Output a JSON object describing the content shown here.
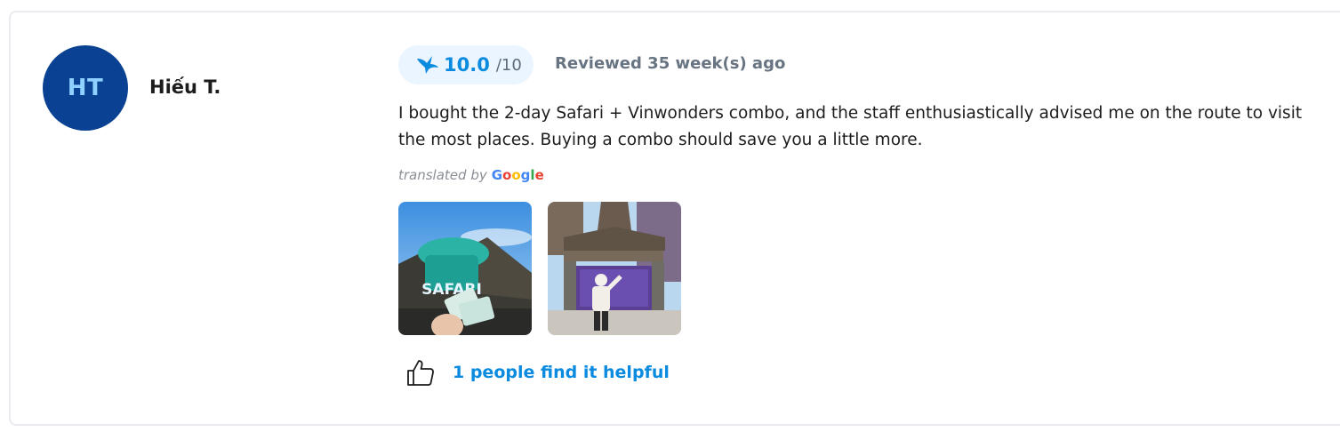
{
  "reviewer": {
    "initials": "HT",
    "name": "Hiếu T."
  },
  "rating": {
    "score": "10.0",
    "scale": "/10"
  },
  "review": {
    "date": "Reviewed 35 week(s) ago",
    "text": "I bought the 2-day Safari + Vinwonders combo, and the staff enthusiastically advised me on the route to visit the most places. Buying a combo should save you a little more.",
    "translated_by": "translated by",
    "translator": "Google"
  },
  "photos": [
    {
      "sign_text": "SAFARI"
    },
    {
      "description": "castle-sign"
    }
  ],
  "helpful": {
    "label": "1 people find it helpful"
  },
  "colors": {
    "accent": "#0b8be0",
    "avatar_bg": "#0b4192",
    "badge_bg": "#eaf5ff"
  }
}
